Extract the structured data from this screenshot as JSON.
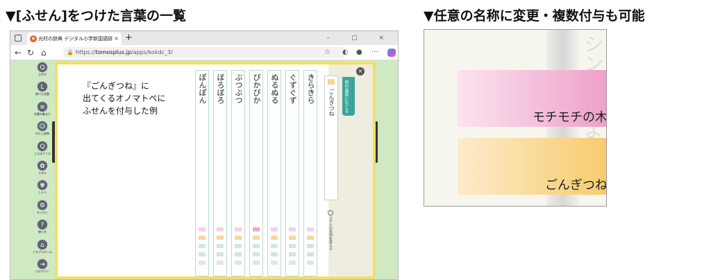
{
  "headings": {
    "left": "▼[ふせん]をつけた言葉の一覧",
    "right": "▼任意の名称に変更・複数付与も可能"
  },
  "browser": {
    "tab_title": "光村の辞典 デジタル小学新国語辞",
    "tab_close": "×",
    "new_tab": "+",
    "window_controls": "– ▢ ×",
    "url_prefix": "https://",
    "url_host": "tomosplus.jp",
    "url_path": "/apps/kokdc_3/"
  },
  "sidebar": {
    "items": [
      {
        "icon": "search-icon",
        "glyph": "Q",
        "label": "さがす"
      },
      {
        "icon": "history-icon",
        "glyph": "L",
        "label": "調べた言葉"
      },
      {
        "icon": "ruby-icon",
        "glyph": "≡",
        "label": "言葉の集まり"
      },
      {
        "icon": "my-dict-icon",
        "glyph": "☺",
        "label": "わたし辞典"
      },
      {
        "icon": "quiz-icon",
        "glyph": "Q",
        "label": "ことばクイズ"
      },
      {
        "icon": "medal-icon",
        "glyph": "✿",
        "label": "メダル"
      },
      {
        "icon": "mode-icon",
        "glyph": "✾",
        "label": "しらべ"
      },
      {
        "icon": "settings-icon",
        "glyph": "⚙",
        "label": "せってい"
      },
      {
        "icon": "help-icon",
        "glyph": "?",
        "label": "使い方"
      },
      {
        "icon": "home-icon",
        "glyph": "⌂",
        "label": "トモプラホーム"
      },
      {
        "icon": "logout-icon",
        "glyph": "⇥",
        "label": "ログアウト"
      }
    ]
  },
  "annotation": {
    "line1": "『ごんぎつね』に",
    "line2": "出てくるオノマトペに",
    "line3": "ふせんを付与した例"
  },
  "words": [
    "きらきら",
    "ぐずぐず",
    "ぬるぬる",
    "ぴかぴか",
    "ぶつぶつ",
    "ぼろぼろ",
    "ぽんぽん"
  ],
  "tray": {
    "word": "ごんぎつね",
    "back_label": "前の画面にもどる",
    "close": "×",
    "rename_note": "ふせんの名前を変える"
  },
  "zoom": {
    "tag1": "モチモチの木",
    "tag2": "ごんぎつね",
    "faint1": "シン",
    "faint2": "よ み"
  },
  "colors": {
    "frame": "#f0e064",
    "back_tab": "#3aa59a",
    "tag_pink": "#ee9fc8",
    "tag_orange": "#f7cb6c"
  }
}
